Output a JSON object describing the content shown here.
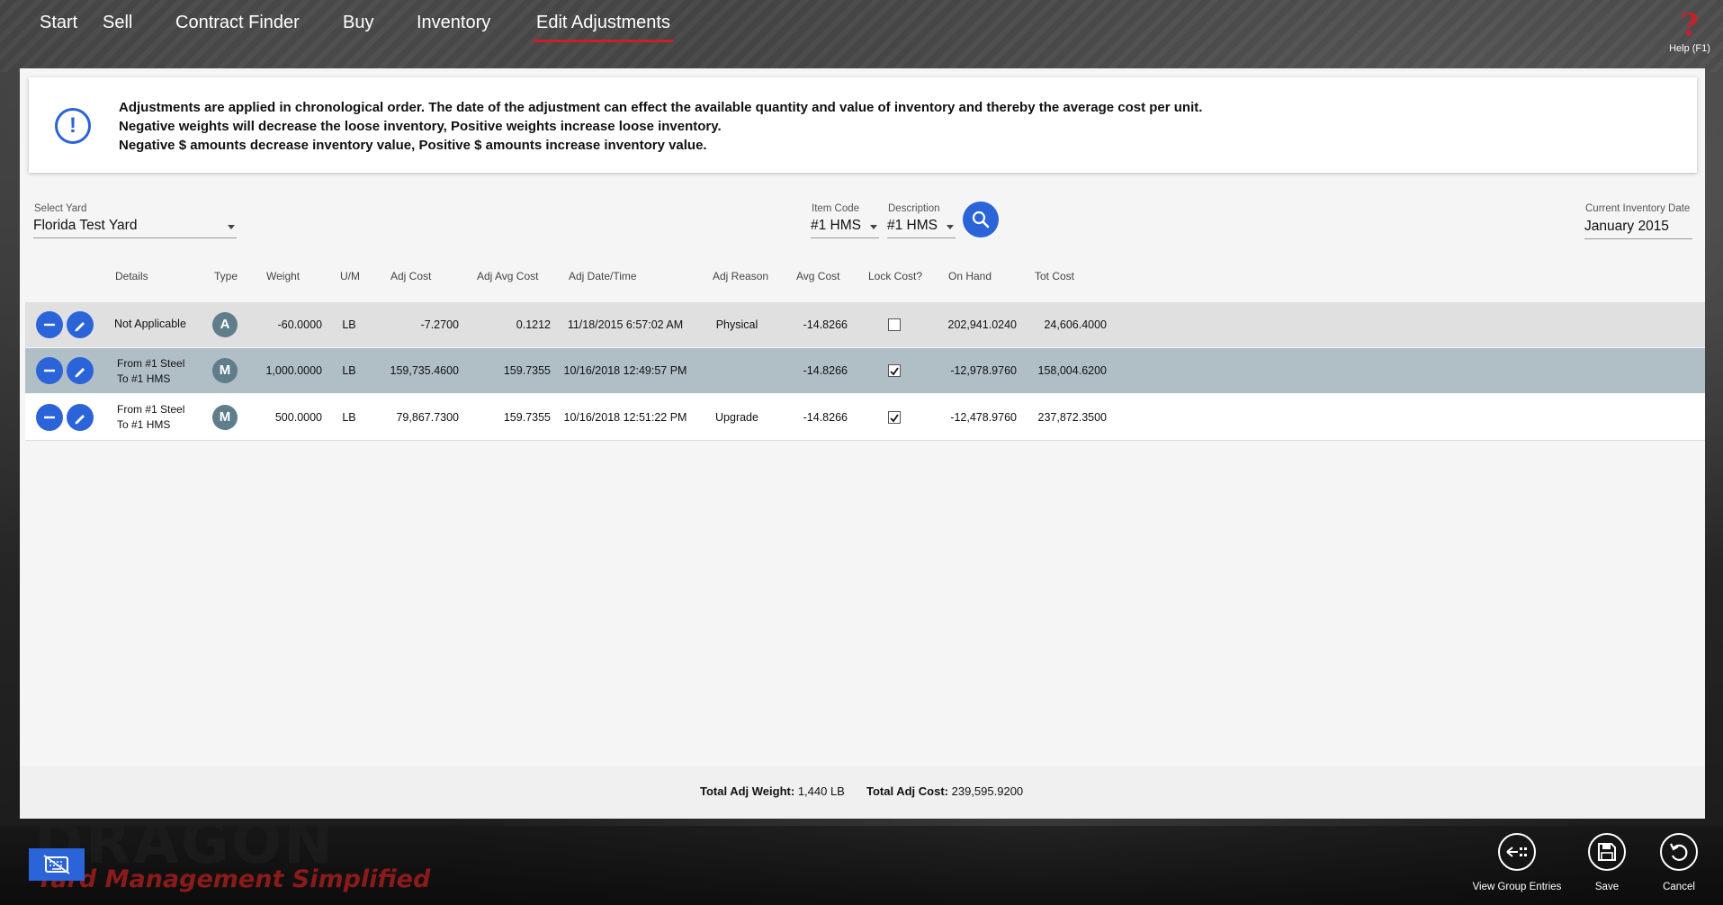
{
  "nav": {
    "items": [
      "Start",
      "Sell",
      "Contract Finder",
      "Buy",
      "Inventory",
      "Edit Adjustments"
    ],
    "help_label": "Help (F1)"
  },
  "info": {
    "line1": "Adjustments are applied in chronological order. The date of the adjustment can effect the available quantity and value of inventory and thereby the average cost per unit.",
    "line2": "Negative weights will decrease the loose inventory, Positive weights increase loose inventory.",
    "line3": "Negative $ amounts decrease inventory value, Positive $ amounts increase inventory value."
  },
  "filters": {
    "yard_label": "Select Yard",
    "yard_value": "Florida Test Yard",
    "item_code_label": "Item Code",
    "item_code_value": "#1 HMS",
    "description_label": "Description",
    "description_value": "#1 HMS",
    "inv_date_label": "Current Inventory Date",
    "inv_date_value": "January 2015"
  },
  "table": {
    "headers": [
      "Details",
      "Type",
      "Weight",
      "U/M",
      "Adj Cost",
      "Adj Avg Cost",
      "Adj Date/Time",
      "Adj Reason",
      "Avg Cost",
      "Lock Cost?",
      "On Hand",
      "Tot Cost"
    ],
    "rows": [
      {
        "details1": "Not Applicable",
        "details2": "",
        "type": "A",
        "weight": "-60.0000",
        "um": "LB",
        "adj_cost": "-7.2700",
        "adj_avg_cost": "0.1212",
        "date": "11/18/2015 6:57:02 AM",
        "reason": "Physical",
        "avg_cost": "-14.8266",
        "locked": false,
        "on_hand": "202,941.0240",
        "tot_cost": "24,606.4000"
      },
      {
        "details1": "From #1 Steel",
        "details2": "To #1 HMS",
        "type": "M",
        "weight": "1,000.0000",
        "um": "LB",
        "adj_cost": "159,735.4600",
        "adj_avg_cost": "159.7355",
        "date": "10/16/2018 12:49:57 PM",
        "reason": "",
        "avg_cost": "-14.8266",
        "locked": true,
        "on_hand": "-12,978.9760",
        "tot_cost": "158,004.6200"
      },
      {
        "details1": "From #1 Steel",
        "details2": "To #1 HMS",
        "type": "M",
        "weight": "500.0000",
        "um": "LB",
        "adj_cost": "79,867.7300",
        "adj_avg_cost": "159.7355",
        "date": "10/16/2018 12:51:22 PM",
        "reason": "Upgrade",
        "avg_cost": "-14.8266",
        "locked": true,
        "on_hand": "-12,478.9760",
        "tot_cost": "237,872.3500"
      }
    ]
  },
  "totals": {
    "weight_label": "Total Adj Weight:",
    "weight_value": "1,440 LB",
    "cost_label": "Total Adj Cost:",
    "cost_value": "239,595.9200"
  },
  "bottom": {
    "brand_main": "DRAGON",
    "brand_sub": "Yard Management Simplified",
    "view_group_label": "View Group Entries",
    "save_label": "Save",
    "cancel_label": "Cancel"
  },
  "colors": {
    "accent": "#2b63d9",
    "brand_red": "#c8202a",
    "selected_row": "#b0bec5",
    "first_row": "#e0e0e0"
  }
}
